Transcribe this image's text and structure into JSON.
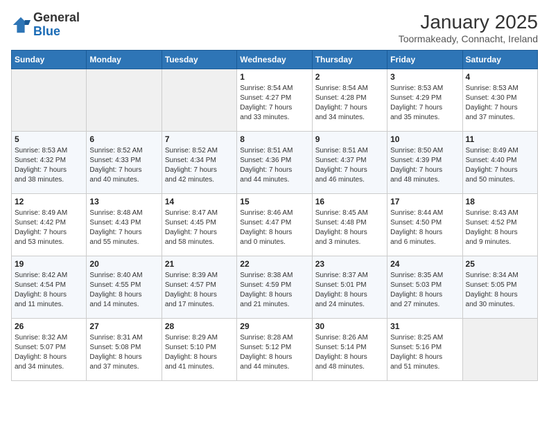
{
  "logo": {
    "text_general": "General",
    "text_blue": "Blue"
  },
  "title": "January 2025",
  "subtitle": "Toormakeady, Connacht, Ireland",
  "headers": [
    "Sunday",
    "Monday",
    "Tuesday",
    "Wednesday",
    "Thursday",
    "Friday",
    "Saturday"
  ],
  "weeks": [
    [
      {
        "day": "",
        "info": ""
      },
      {
        "day": "",
        "info": ""
      },
      {
        "day": "",
        "info": ""
      },
      {
        "day": "1",
        "info": "Sunrise: 8:54 AM\nSunset: 4:27 PM\nDaylight: 7 hours\nand 33 minutes."
      },
      {
        "day": "2",
        "info": "Sunrise: 8:54 AM\nSunset: 4:28 PM\nDaylight: 7 hours\nand 34 minutes."
      },
      {
        "day": "3",
        "info": "Sunrise: 8:53 AM\nSunset: 4:29 PM\nDaylight: 7 hours\nand 35 minutes."
      },
      {
        "day": "4",
        "info": "Sunrise: 8:53 AM\nSunset: 4:30 PM\nDaylight: 7 hours\nand 37 minutes."
      }
    ],
    [
      {
        "day": "5",
        "info": "Sunrise: 8:53 AM\nSunset: 4:32 PM\nDaylight: 7 hours\nand 38 minutes."
      },
      {
        "day": "6",
        "info": "Sunrise: 8:52 AM\nSunset: 4:33 PM\nDaylight: 7 hours\nand 40 minutes."
      },
      {
        "day": "7",
        "info": "Sunrise: 8:52 AM\nSunset: 4:34 PM\nDaylight: 7 hours\nand 42 minutes."
      },
      {
        "day": "8",
        "info": "Sunrise: 8:51 AM\nSunset: 4:36 PM\nDaylight: 7 hours\nand 44 minutes."
      },
      {
        "day": "9",
        "info": "Sunrise: 8:51 AM\nSunset: 4:37 PM\nDaylight: 7 hours\nand 46 minutes."
      },
      {
        "day": "10",
        "info": "Sunrise: 8:50 AM\nSunset: 4:39 PM\nDaylight: 7 hours\nand 48 minutes."
      },
      {
        "day": "11",
        "info": "Sunrise: 8:49 AM\nSunset: 4:40 PM\nDaylight: 7 hours\nand 50 minutes."
      }
    ],
    [
      {
        "day": "12",
        "info": "Sunrise: 8:49 AM\nSunset: 4:42 PM\nDaylight: 7 hours\nand 53 minutes."
      },
      {
        "day": "13",
        "info": "Sunrise: 8:48 AM\nSunset: 4:43 PM\nDaylight: 7 hours\nand 55 minutes."
      },
      {
        "day": "14",
        "info": "Sunrise: 8:47 AM\nSunset: 4:45 PM\nDaylight: 7 hours\nand 58 minutes."
      },
      {
        "day": "15",
        "info": "Sunrise: 8:46 AM\nSunset: 4:47 PM\nDaylight: 8 hours\nand 0 minutes."
      },
      {
        "day": "16",
        "info": "Sunrise: 8:45 AM\nSunset: 4:48 PM\nDaylight: 8 hours\nand 3 minutes."
      },
      {
        "day": "17",
        "info": "Sunrise: 8:44 AM\nSunset: 4:50 PM\nDaylight: 8 hours\nand 6 minutes."
      },
      {
        "day": "18",
        "info": "Sunrise: 8:43 AM\nSunset: 4:52 PM\nDaylight: 8 hours\nand 9 minutes."
      }
    ],
    [
      {
        "day": "19",
        "info": "Sunrise: 8:42 AM\nSunset: 4:54 PM\nDaylight: 8 hours\nand 11 minutes."
      },
      {
        "day": "20",
        "info": "Sunrise: 8:40 AM\nSunset: 4:55 PM\nDaylight: 8 hours\nand 14 minutes."
      },
      {
        "day": "21",
        "info": "Sunrise: 8:39 AM\nSunset: 4:57 PM\nDaylight: 8 hours\nand 17 minutes."
      },
      {
        "day": "22",
        "info": "Sunrise: 8:38 AM\nSunset: 4:59 PM\nDaylight: 8 hours\nand 21 minutes."
      },
      {
        "day": "23",
        "info": "Sunrise: 8:37 AM\nSunset: 5:01 PM\nDaylight: 8 hours\nand 24 minutes."
      },
      {
        "day": "24",
        "info": "Sunrise: 8:35 AM\nSunset: 5:03 PM\nDaylight: 8 hours\nand 27 minutes."
      },
      {
        "day": "25",
        "info": "Sunrise: 8:34 AM\nSunset: 5:05 PM\nDaylight: 8 hours\nand 30 minutes."
      }
    ],
    [
      {
        "day": "26",
        "info": "Sunrise: 8:32 AM\nSunset: 5:07 PM\nDaylight: 8 hours\nand 34 minutes."
      },
      {
        "day": "27",
        "info": "Sunrise: 8:31 AM\nSunset: 5:08 PM\nDaylight: 8 hours\nand 37 minutes."
      },
      {
        "day": "28",
        "info": "Sunrise: 8:29 AM\nSunset: 5:10 PM\nDaylight: 8 hours\nand 41 minutes."
      },
      {
        "day": "29",
        "info": "Sunrise: 8:28 AM\nSunset: 5:12 PM\nDaylight: 8 hours\nand 44 minutes."
      },
      {
        "day": "30",
        "info": "Sunrise: 8:26 AM\nSunset: 5:14 PM\nDaylight: 8 hours\nand 48 minutes."
      },
      {
        "day": "31",
        "info": "Sunrise: 8:25 AM\nSunset: 5:16 PM\nDaylight: 8 hours\nand 51 minutes."
      },
      {
        "day": "",
        "info": ""
      }
    ]
  ]
}
